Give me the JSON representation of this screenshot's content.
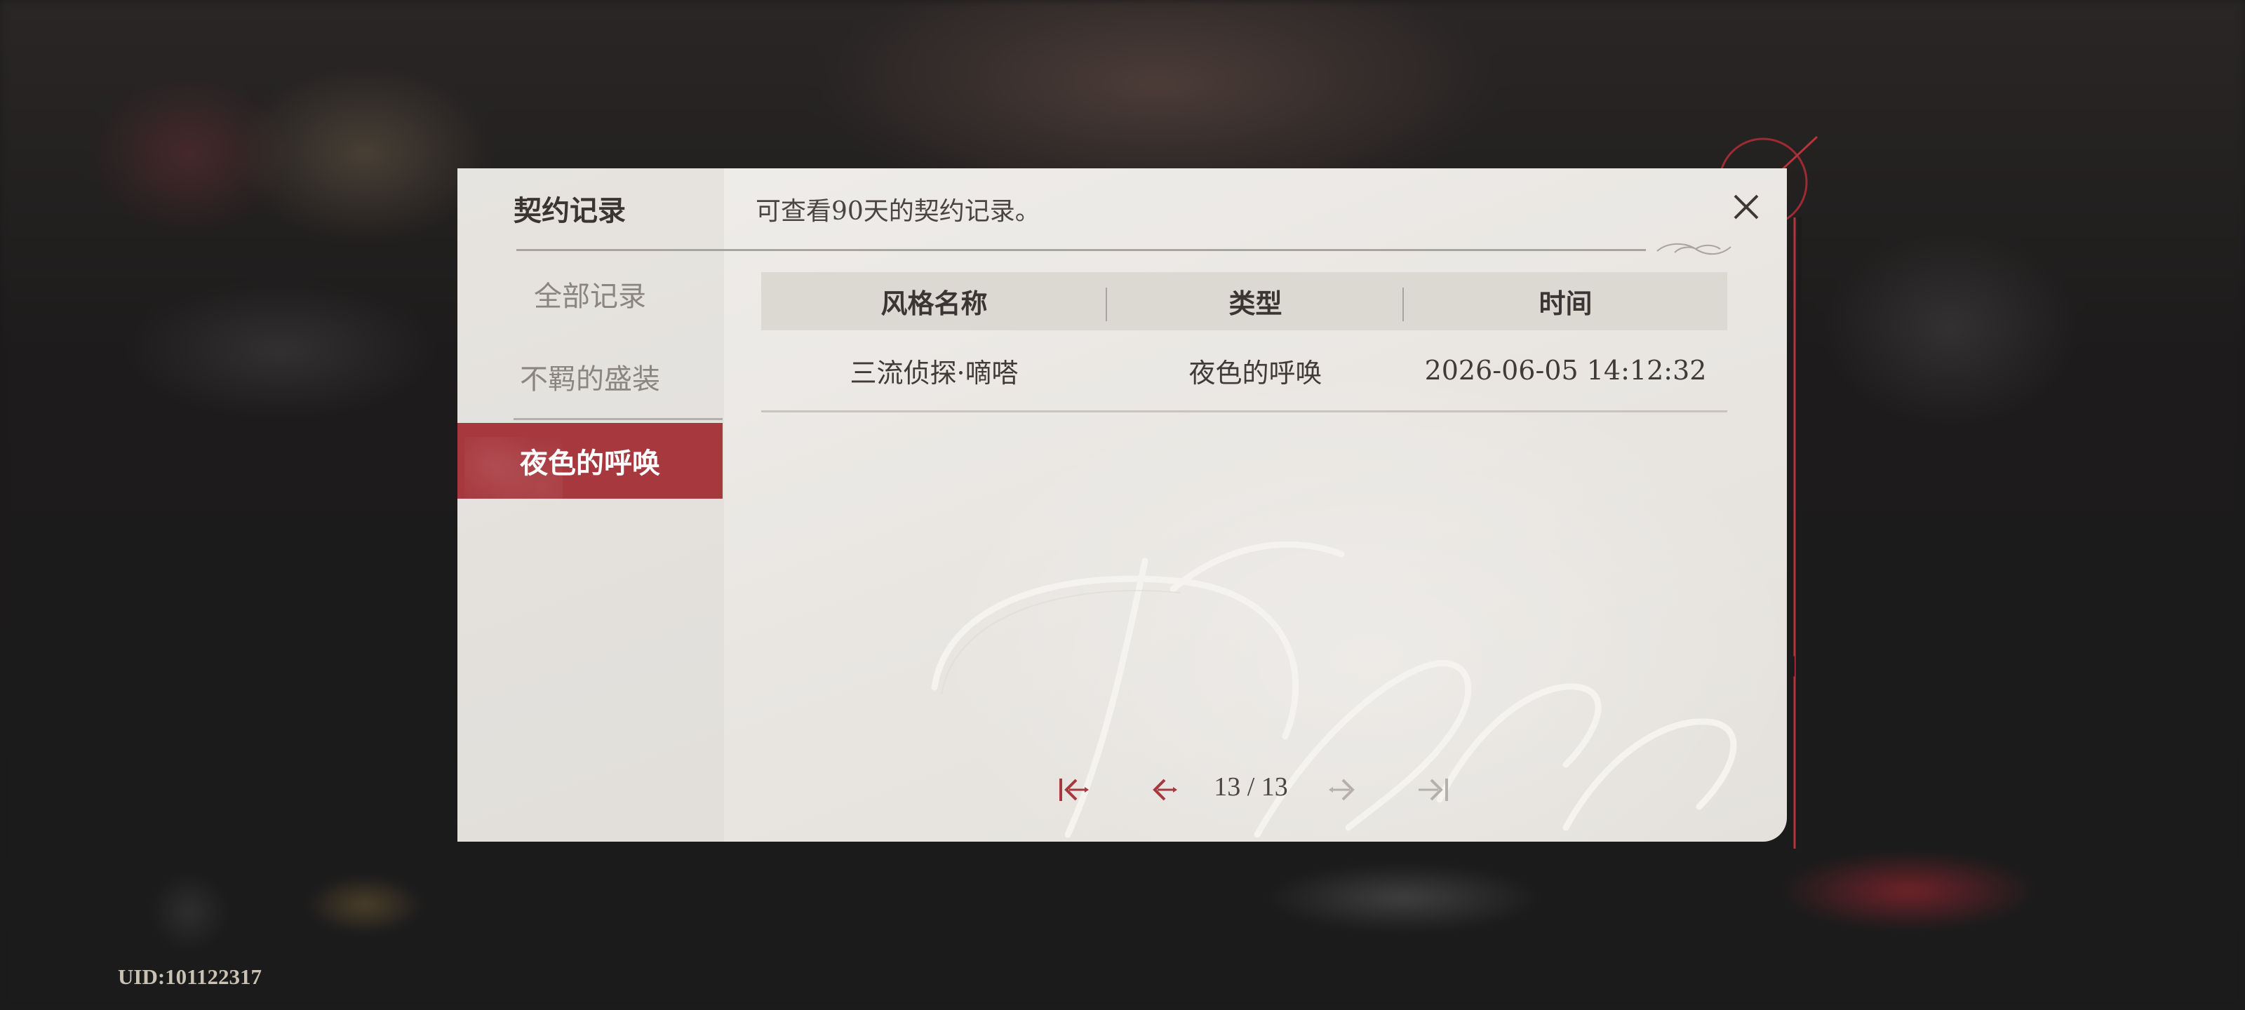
{
  "dialog": {
    "title": "契约记录",
    "description": "可查看90天的契约记录。"
  },
  "tabs": [
    {
      "label": "全部记录",
      "active": false
    },
    {
      "label": "不羁的盛装",
      "active": false
    },
    {
      "label": "夜色的呼唤",
      "active": true
    }
  ],
  "table": {
    "headers": [
      "风格名称",
      "类型",
      "时间"
    ],
    "rows": [
      [
        "三流侦探·嘀嗒",
        "夜色的呼唤",
        "2026-06-05 14:12:32"
      ]
    ]
  },
  "pagination": {
    "text": "13 / 13",
    "current": 13,
    "total": 13
  },
  "footer": {
    "uid": "UID:101122317"
  },
  "colors": {
    "accent": "#a6383e",
    "paper": "#ebe8e4",
    "header_bg": "#dcd8d2",
    "background": "#1b1b1c"
  },
  "icons": [
    "close-icon",
    "first-page-icon",
    "prev-page-icon",
    "next-page-icon",
    "last-page-icon"
  ]
}
